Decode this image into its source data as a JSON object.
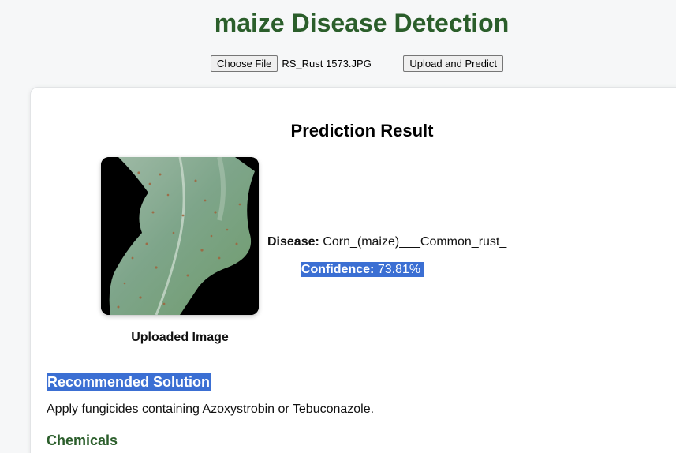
{
  "header": {
    "title": "maize Disease Detection"
  },
  "upload": {
    "choose_label": "Choose File",
    "file_name": "RS_Rust 1573.JPG",
    "submit_label": "Upload and Predict"
  },
  "result": {
    "title": "Prediction Result",
    "image_caption": "Uploaded Image",
    "disease_label": "Disease:",
    "disease_value": "Corn_(maize)___Common_rust_",
    "confidence_label": "Confidence:",
    "confidence_value": "73.81%"
  },
  "solution": {
    "heading": "Recommended Solution",
    "text": "Apply fungicides containing Azoxystrobin or Tebuconazole.",
    "chemicals_heading": "Chemicals"
  },
  "colors": {
    "title_green": "#2b5e2b",
    "selection_blue": "#3b6fd3"
  }
}
